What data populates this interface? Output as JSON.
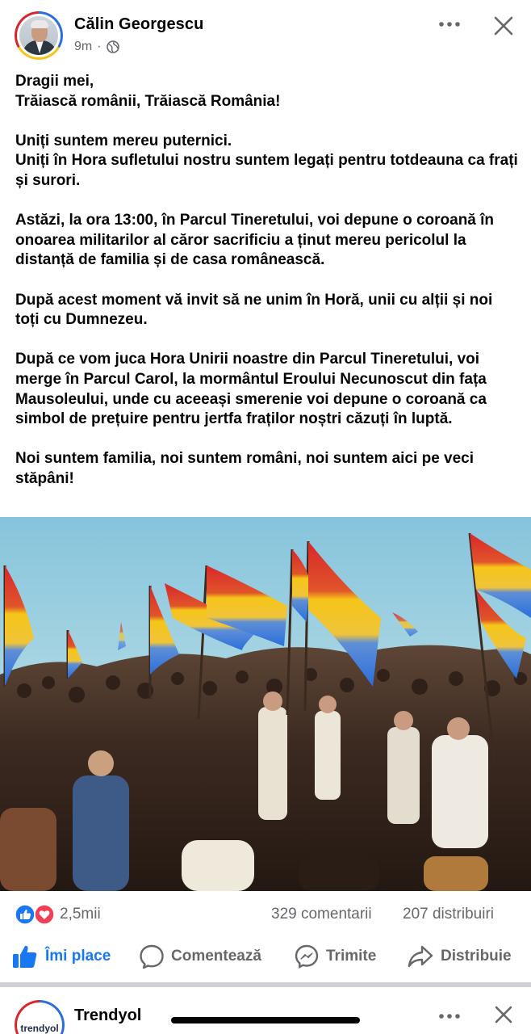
{
  "post": {
    "author": "Călin Georgescu",
    "time": "9m",
    "separator": "·",
    "paragraphs": [
      "Dragii mei,\nTrăiască românii, Trăiască România!",
      "Uniți suntem mereu puternici.\nUniți în Hora sufletului nostru suntem legați pentru totdeauna ca frați și surori.",
      "Astăzi, la ora 13:00, în Parcul Tineretului, voi depune o coroană în onoarea militarilor al căror sacrificiu a ținut mereu pericolul la distanță de familia și de casa românească.",
      "După acest moment vă invit să ne unim în Horă, unii cu alții și noi toți cu Dumnezeu.",
      "După ce vom juca Hora Unirii noastre din Parcul Tineretului, voi merge în Parcul Carol, la mormântul Eroului Necunoscut din fața Mausoleului, unde cu aceeași smerenie voi depune o coroană ca simbol de prețuire pentru jertfa fraților noștri căzuți în luptă.",
      "Noi suntem familia, noi suntem români, noi suntem aici pe veci stăpâni!"
    ],
    "reactions_count": "2,5mii",
    "comments_count": "329 comentarii",
    "shares_count": "207 distribuiri"
  },
  "actions": {
    "like": "Îmi place",
    "comment": "Comentează",
    "send": "Trimite",
    "share": "Distribuie"
  },
  "next_post": {
    "author": "Trendyol",
    "avatar_text": "trendyol"
  },
  "colors": {
    "like_blue": "#1877f2",
    "love_red": "#f33e58",
    "secondary_text": "#65676b",
    "flag_red": "#d8262c",
    "flag_yellow": "#f5c518",
    "flag_blue": "#2a6fdb"
  }
}
